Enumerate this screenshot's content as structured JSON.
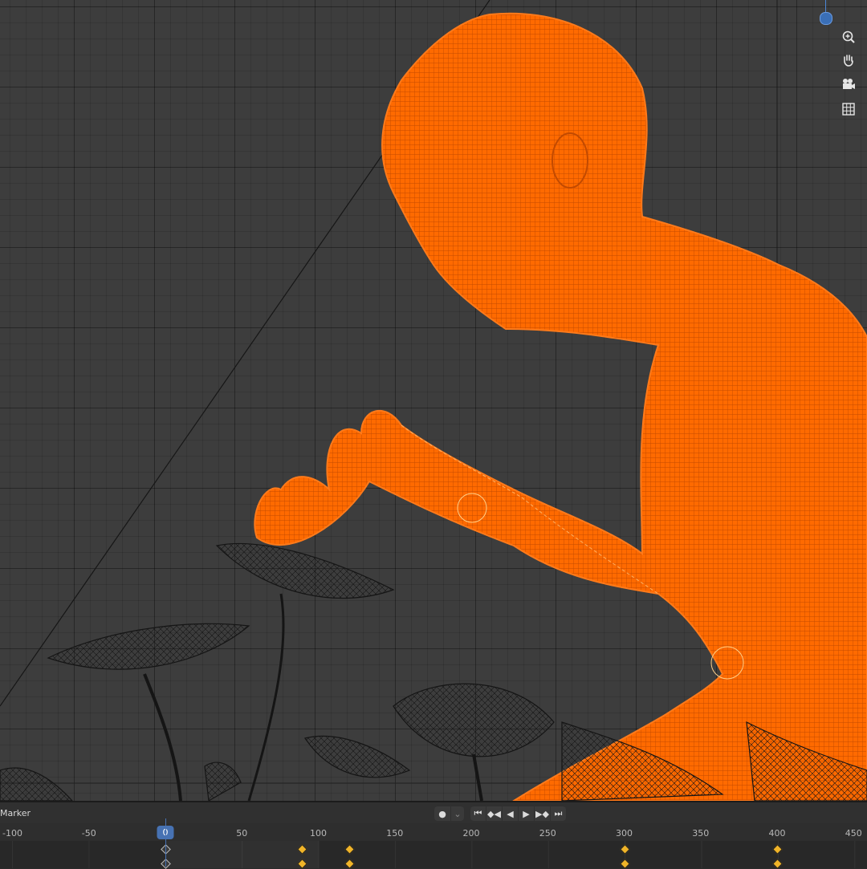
{
  "viewport": {
    "nav_icons": [
      "zoom-icon",
      "hand-pan-icon",
      "camera-icon",
      "grid-ortho-icon"
    ],
    "colors": {
      "selected": "#ff5f00",
      "wire_dark": "#141414",
      "background": "#3d3d3d"
    }
  },
  "timeline": {
    "marker_label": "Marker",
    "current_frame": "0",
    "ruler_ticks": [
      "-100",
      "-50",
      "0",
      "50",
      "100",
      "150",
      "200",
      "250",
      "300",
      "350",
      "400",
      "450"
    ],
    "keyframes": [
      0,
      89,
      120,
      300,
      400
    ],
    "transport_icons": [
      "record-icon",
      "dropdown-icon",
      "jump-start-icon",
      "prev-keyframe-icon",
      "play-reverse-icon",
      "play-icon",
      "next-keyframe-icon",
      "jump-end-icon"
    ]
  }
}
